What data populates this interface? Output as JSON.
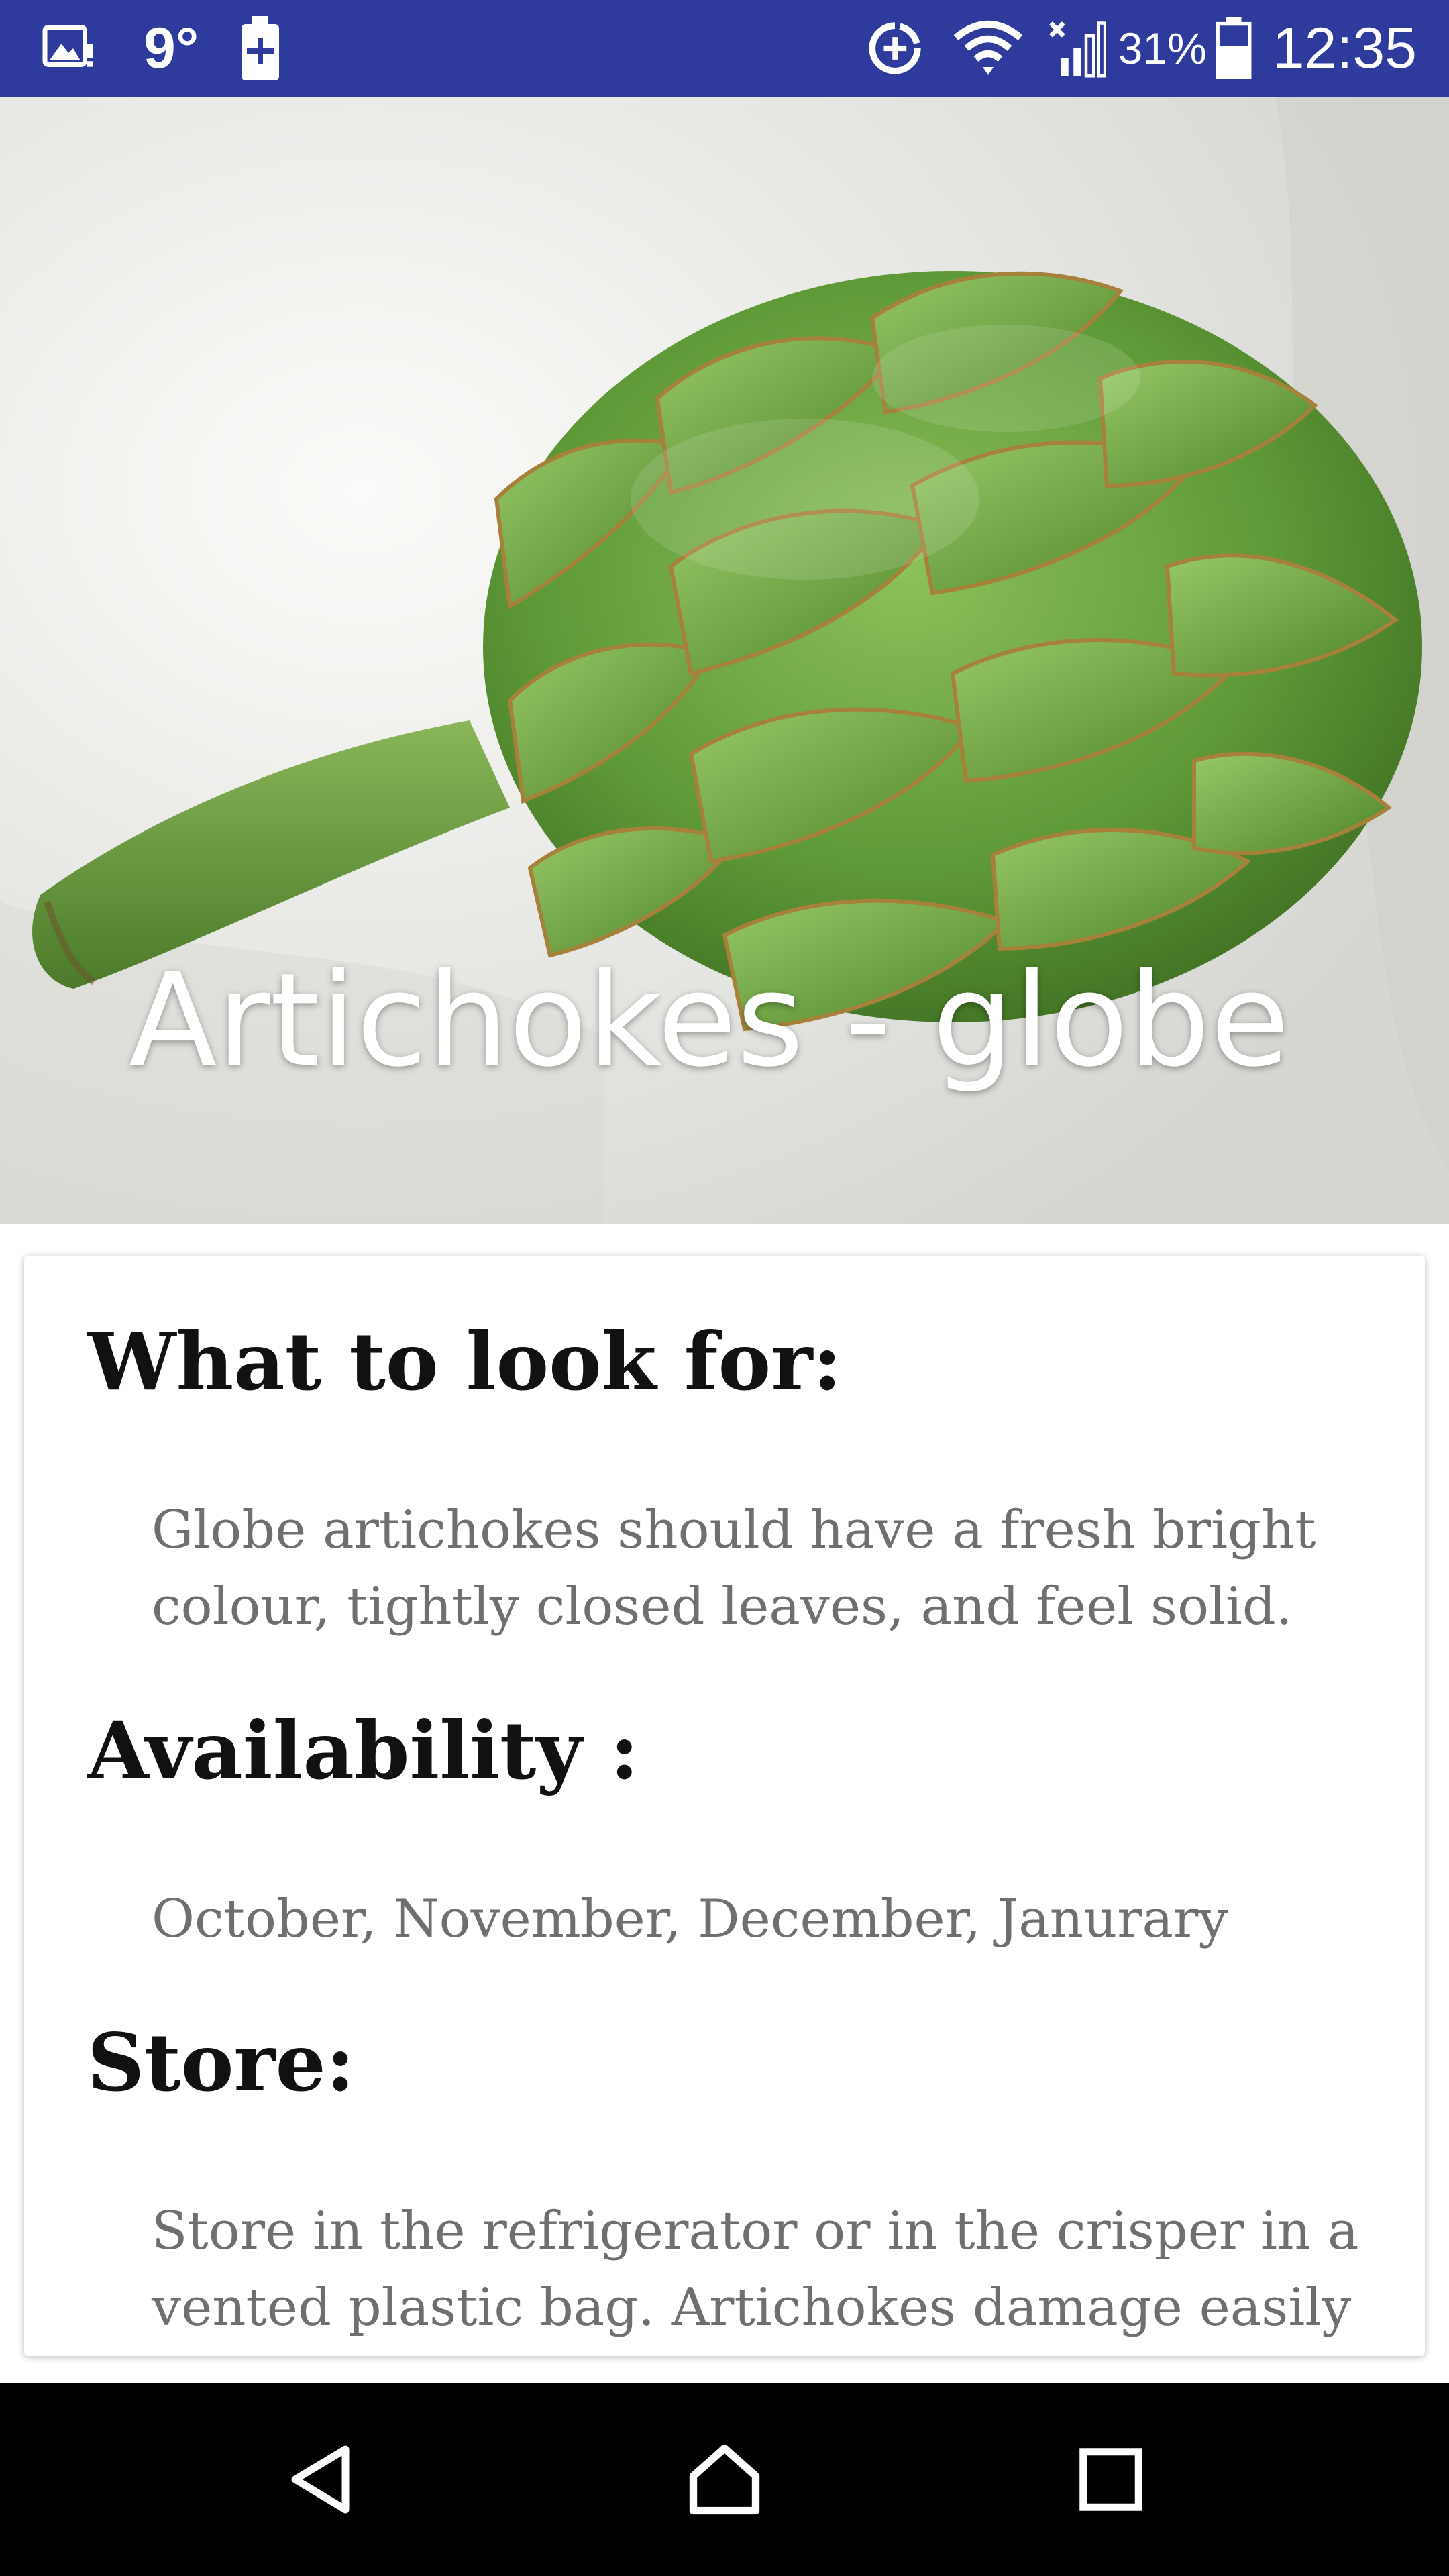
{
  "status_bar": {
    "temperature": "9°",
    "battery_percent": "31%",
    "time": "12:35",
    "icons": {
      "left": [
        "image-notification-icon",
        "battery-saver-icon"
      ],
      "right": [
        "data-saver-icon",
        "wifi-icon",
        "signal-icon",
        "battery-icon"
      ]
    }
  },
  "hero": {
    "title": "Artichokes - globe",
    "image": "artichoke-image"
  },
  "content": {
    "sections": [
      {
        "heading": "What to look for:",
        "body": "Globe artichokes should have a fresh bright colour, tightly closed leaves, and feel solid."
      },
      {
        "heading": "Availability :",
        "body": "October, November, December, Janurary"
      },
      {
        "heading": "Store:",
        "body": "Store in the refrigerator or in the crisper in a vented plastic bag. Artichokes damage easily"
      }
    ]
  },
  "nav_bar": {
    "icons": [
      "back-icon",
      "home-icon",
      "recents-icon"
    ]
  },
  "colors": {
    "status_bar": "#2f3b9c",
    "heading_text": "#111111",
    "body_text": "#6f6f6f",
    "nav_bar": "#000000"
  }
}
